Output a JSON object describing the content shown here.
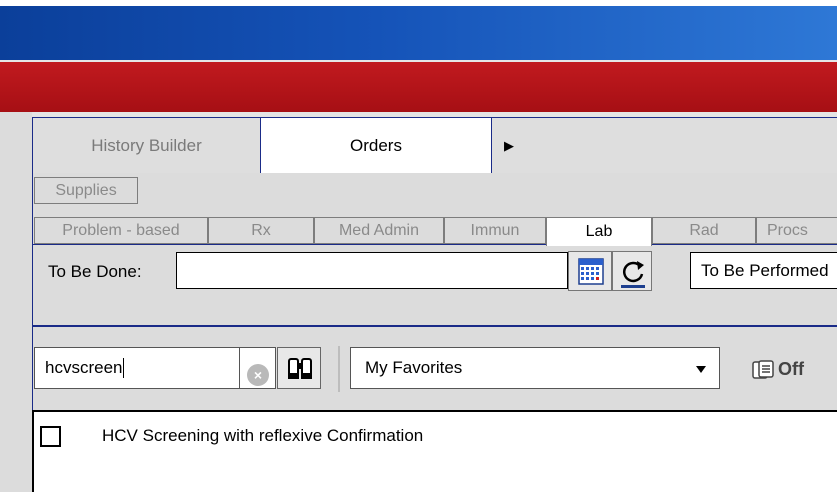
{
  "tabs": {
    "history_builder": "History Builder",
    "orders": "Orders",
    "more": "▶"
  },
  "subtabs": {
    "supplies": "Supplies",
    "items": [
      "Problem - based",
      "Rx",
      "Med Admin",
      "Immun",
      "Lab",
      "Rad",
      "Procs"
    ],
    "active": "Lab"
  },
  "to_be_done": {
    "label": "To Be Done:",
    "value": "",
    "performed_select": "To Be Performed"
  },
  "search": {
    "value": "hcvscreen",
    "favorites": "My Favorites",
    "off_label": "Off"
  },
  "results": [
    {
      "label": "HCV Screening with reflexive Confirmation",
      "checked": false
    }
  ],
  "colors": {
    "blue_bar": "#1553b8",
    "red_bar": "#a60f14",
    "tab_border": "#1a2b88"
  },
  "icons": [
    "calendar-icon",
    "refresh-icon",
    "clear-icon",
    "binoculars-icon",
    "favorites-off-icon",
    "dropdown-arrow-icon"
  ]
}
